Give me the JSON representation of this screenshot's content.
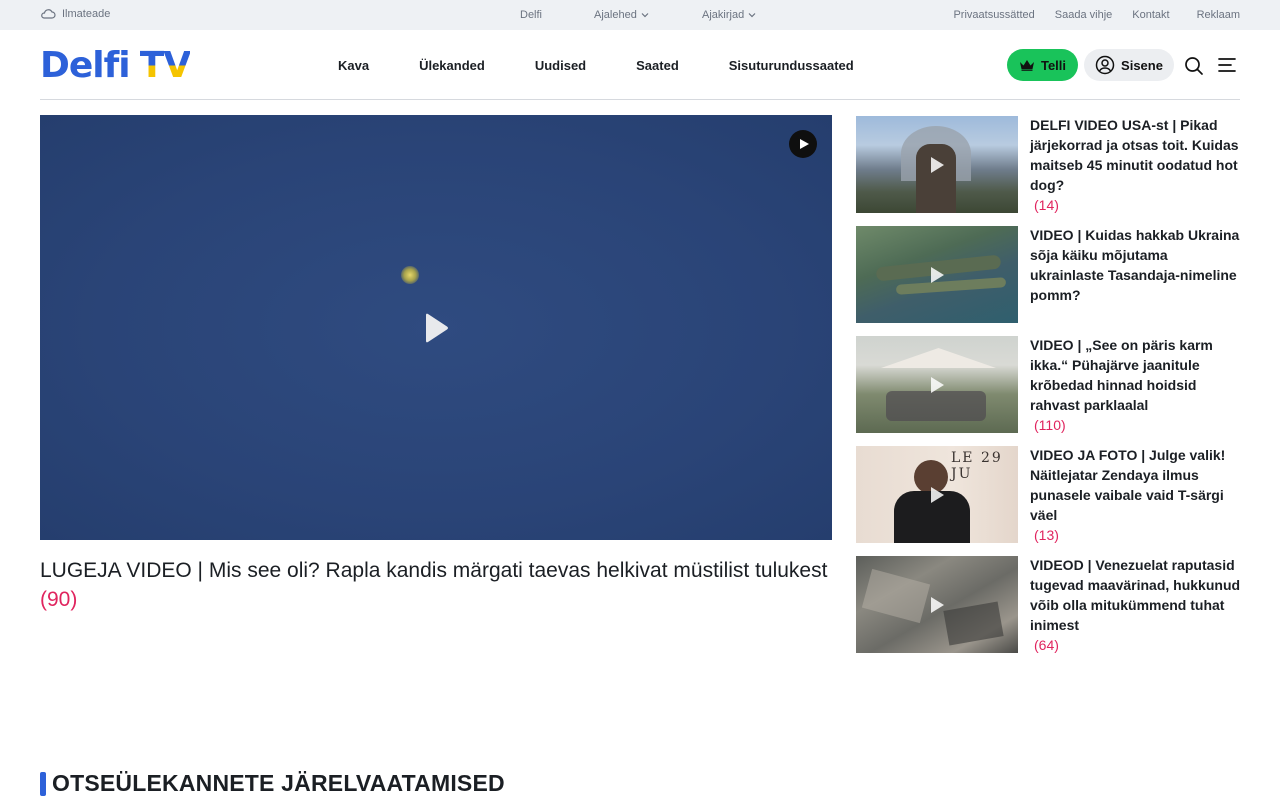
{
  "topbar": {
    "weather_label": "Ilmateade",
    "center_links": [
      {
        "label": "Delfi",
        "dropdown": false
      },
      {
        "label": "Ajalehed",
        "dropdown": true
      },
      {
        "label": "Ajakirjad",
        "dropdown": true
      }
    ],
    "right_links": [
      "Privaatsussätted",
      "Saada vihje",
      "Kontakt",
      "Reklaam"
    ]
  },
  "header": {
    "logo_part1": "Delfi",
    "logo_part2": "TV",
    "nav": [
      "Kava",
      "Ülekanded",
      "Uudised",
      "Saated",
      "Sisuturundussaated"
    ],
    "subscribe_label": "Telli",
    "login_label": "Sisene"
  },
  "colors": {
    "brand_blue": "#2d61d9",
    "brand_yellow": "#f5c400",
    "subscribe_green": "#19c35a",
    "comment_pink": "#e0245e"
  },
  "main_video": {
    "title": "LUGEJA VIDEO | Mis see oli? Rapla kandis märgati taevas helkivat müstilist tulukest",
    "comment_count": "(90)"
  },
  "side_videos": [
    {
      "title": "DELFI VIDEO USA-st | Pikad järjekorrad ja otsas toit. Kuidas maitseb 45 minutit oodatud hot dog?",
      "comment_count": "(14)"
    },
    {
      "title": "VIDEO | Kuidas hakkab Ukraina sõja käiku mõjutama ukrainlaste Tasandaja-nimeline pomm?",
      "comment_count": ""
    },
    {
      "title": "VIDEO | „See on päris karm ikka.“ Pühajärve jaanitule krõbedad hinnad hoidsid rahvast parklaalal",
      "comment_count": "(110)"
    },
    {
      "title": "VIDEO JA FOTO | Julge valik! Näitlejatar Zendaya ilmus punasele vaibale vaid T-särgi väel",
      "comment_count": "(13)"
    },
    {
      "title": "VIDEOD | Venezuelat raputasid tugevad maavärinad, hukkunud võib olla mitukümmend tuhat inimest",
      "comment_count": "(64)"
    }
  ],
  "section": {
    "title": "OTSEÜLEKANNETE JÄRELVAATAMISED"
  }
}
